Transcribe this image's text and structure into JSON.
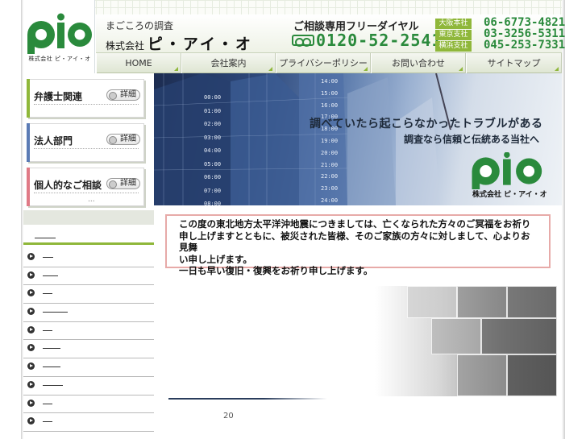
{
  "header": {
    "logo_text": "pio",
    "logo_tag": "株式会社 ピ・アイ・オ",
    "tagline": "まごころの調査",
    "company_prefix": "株式会社",
    "company_name": "ピ・アイ・オ",
    "freedial_label": "ご相談専用フリーダイヤル",
    "freedial_number": "0120-52-2541",
    "branches": [
      {
        "name": "大阪本社",
        "phone": "06-6773-4821"
      },
      {
        "name": "東京支社",
        "phone": "03-3256-5311"
      },
      {
        "name": "横浜支社",
        "phone": "045-253-7331"
      }
    ]
  },
  "nav": {
    "items": [
      {
        "label": "HOME"
      },
      {
        "label": "会社案内"
      },
      {
        "label": "プライバシーポリシー"
      },
      {
        "label": "お問い合わせ"
      },
      {
        "label": "サイトマップ"
      }
    ]
  },
  "sidebar": {
    "boxes": [
      {
        "title": "弁護士関連",
        "more": "詳細",
        "color": "#8fb73a"
      },
      {
        "title": "法人部門",
        "more": "詳細",
        "color": "#5b7bb5"
      },
      {
        "title": "個人的なご相談",
        "more": "詳細",
        "color": "#e07a86"
      }
    ],
    "ellipsis": "...",
    "list_count": 10
  },
  "hero": {
    "headline": "調べていたら起こらなかったトラブルがある",
    "subline": "調査なら信頼と伝統ある当社へ",
    "logo_text": "pio",
    "logo_tag": "株式会社 ピ・アイ・オ",
    "times_left": [
      "00:00",
      "01:00",
      "02:00",
      "03:00",
      "04:00",
      "05:00",
      "06:00",
      "07:00",
      "08:00"
    ],
    "times_right": [
      "14:00",
      "15:00",
      "16:00",
      "17:00",
      "18:00",
      "19:00",
      "20:00",
      "21:00",
      "22:00",
      "23:00",
      "24:00"
    ]
  },
  "notice": {
    "lines": [
      "この度の東北地方太平洋沖地震につきましては、亡くなられた方々のご冥福をお祈り",
      "申し上げますとともに、被災された皆様、そのご家族の方々に対しまして、心よりお見舞",
      "い申し上げます。",
      "一日も早い復旧・復興をお祈り申し上げます。"
    ]
  },
  "footer": {
    "number": "20"
  },
  "colors": {
    "brand_green": "#2a8a3c",
    "accent_green": "#8fb73a",
    "notice_border": "#e7aaa8"
  }
}
